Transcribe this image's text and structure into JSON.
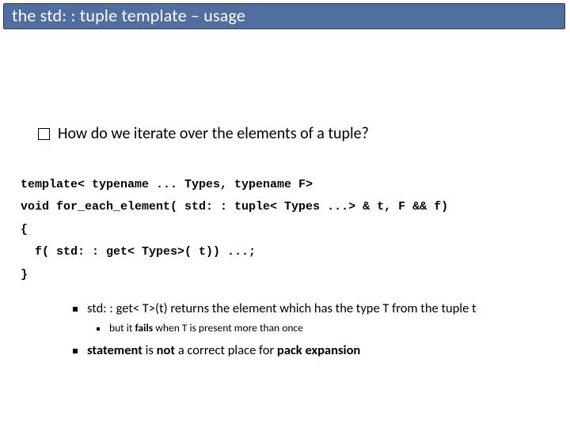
{
  "title": "the std: : tuple template – usage",
  "question": "How do we iterate over the elements of a tuple?",
  "code": {
    "l1": "template< typename ... Types, typename F>",
    "l2": "void for_each_element( std: : tuple< Types ...> & t, F && f)",
    "l3": "{",
    "l4": "  f( std: : get< Types>( t)) ...;",
    "l5": "}"
  },
  "notes": {
    "n1_a": "std: : get< T>(t) returns the element which has the type T from the tuple t",
    "n1_sub_a": "but it ",
    "n1_sub_b": "fails ",
    "n1_sub_c": "when T is present more than once",
    "n2_a": "statement ",
    "n2_b": "is ",
    "n2_c": "not ",
    "n2_d": "a correct place for ",
    "n2_e": "pack expansion"
  }
}
